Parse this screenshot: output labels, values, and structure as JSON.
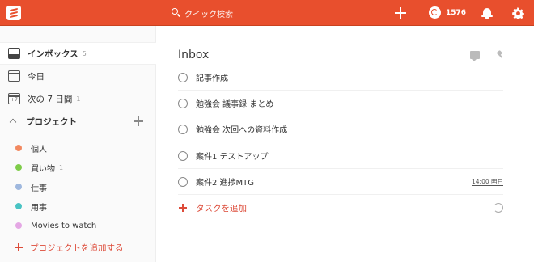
{
  "topbar": {
    "search_placeholder": "クイック検索",
    "karma_count": "1576",
    "bg_color": "#e84f2d"
  },
  "sidebar": {
    "nav": [
      {
        "label": "インボックス",
        "count": "5",
        "icon": "inbox-icon"
      },
      {
        "label": "今日",
        "count": "",
        "icon": "calendar-today-icon"
      },
      {
        "label": "次の 7 日間",
        "count": "1",
        "icon": "calendar-7days-icon",
        "icon_text": "+7"
      }
    ],
    "projects_title": "プロジェクト",
    "projects": [
      {
        "label": "個人",
        "count": "",
        "color": "#f2885f"
      },
      {
        "label": "買い物",
        "count": "1",
        "color": "#7ecc49"
      },
      {
        "label": "仕事",
        "count": "",
        "color": "#9fb8de"
      },
      {
        "label": "用事",
        "count": "",
        "color": "#49c3c3"
      },
      {
        "label": "Movies to watch",
        "count": "",
        "color": "#e4a7e4"
      }
    ],
    "add_project_label": "プロジェクトを追加する"
  },
  "main": {
    "title": "Inbox",
    "tasks": [
      {
        "label": "記事作成",
        "due": ""
      },
      {
        "label": "勉強会 議事録 まとめ",
        "due": ""
      },
      {
        "label": "勉強会 次回への資料作成",
        "due": ""
      },
      {
        "label": "案件1 テストアップ",
        "due": ""
      },
      {
        "label": "案件2 進捗MTG",
        "due": "14:00 明日"
      }
    ],
    "add_task_label": "タスクを追加"
  }
}
